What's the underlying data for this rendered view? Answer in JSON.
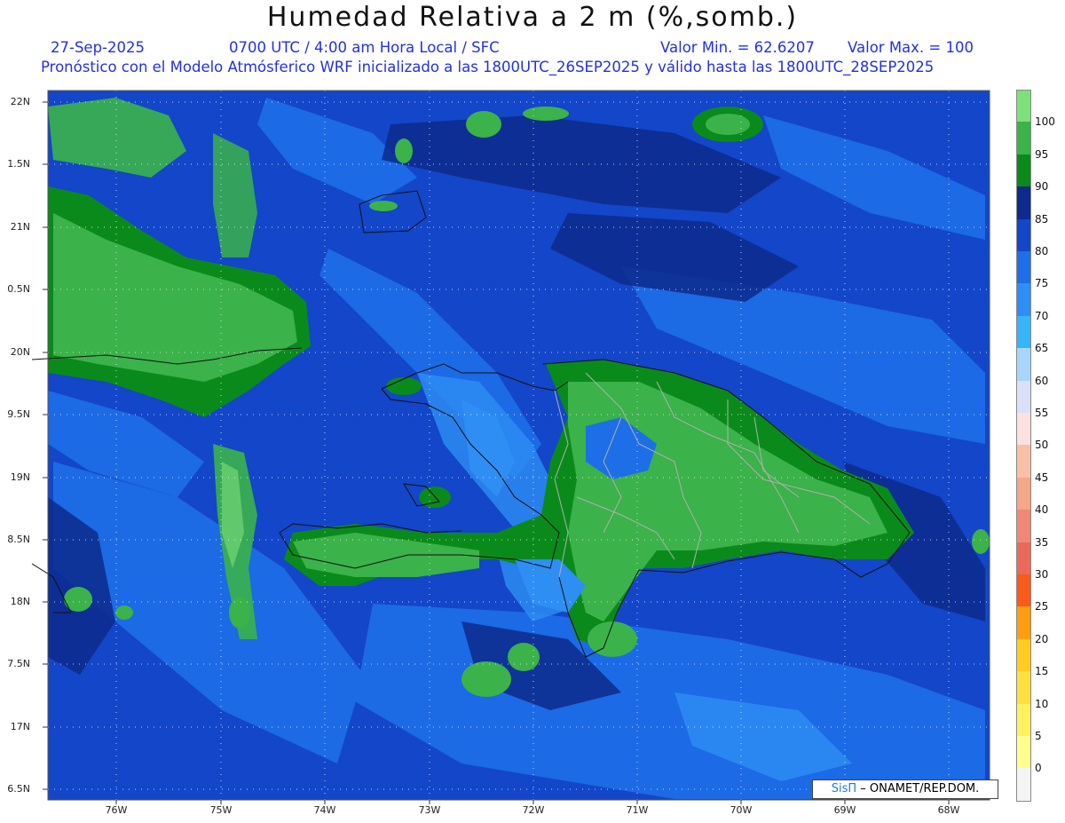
{
  "title": "Humedad Relativa a 2 m (%,somb.)",
  "date": "27-Sep-2025",
  "time": "0700 UTC / 4:00 am Hora Local / SFC",
  "min_value": "Valor Min. = 62.6207",
  "max_value": "Valor Max. = 100",
  "model_info": "Pronóstico con el Modelo Atmósferico WRF inicializado a las 1800UTC_26SEP2025 y válido hasta las  1800UTC_28SEP2025",
  "lat_labels": [
    "22N",
    "1.5N",
    "21N",
    "0.5N",
    "20N",
    "9.5N",
    "19N",
    "8.5N",
    "18N",
    "7.5N",
    "17N",
    "6.5N"
  ],
  "lon_labels": [
    "76W",
    "75W",
    "74W",
    "73W",
    "72W",
    "71W",
    "70W",
    "69W",
    "68W"
  ],
  "colorbar": {
    "labels": [
      "100",
      "95",
      "90",
      "85",
      "80",
      "75",
      "70",
      "65",
      "60",
      "55",
      "50",
      "45",
      "40",
      "35",
      "30",
      "25",
      "20",
      "15",
      "10",
      "5",
      "0"
    ],
    "colors": [
      "#7ee07a",
      "#3bb24a",
      "#0b8a1c",
      "#0d2a8c",
      "#1346c8",
      "#1e6ee8",
      "#2e8ef4",
      "#38b4f8",
      "#a8d6fa",
      "#d9e0f7",
      "#fde0e0",
      "#f8c0a8",
      "#f4a888",
      "#f08878",
      "#ea6a5a",
      "#fb5a1a",
      "#ff9e10",
      "#ffcc20",
      "#fde040",
      "#fff060",
      "#ffff90",
      "#f4f4f4"
    ]
  },
  "credit": {
    "sis": "SisΠ",
    "org": " – ONAMET/REP.DOM."
  }
}
